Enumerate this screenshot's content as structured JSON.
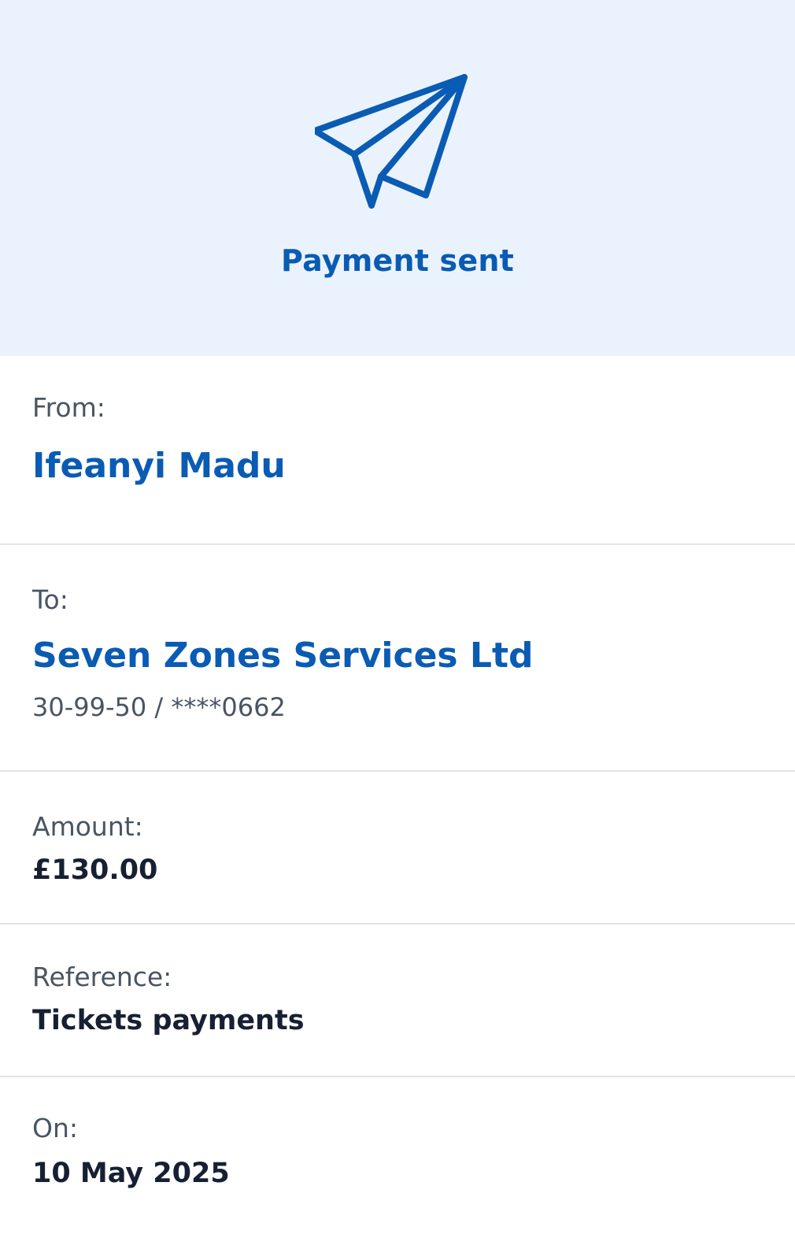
{
  "header": {
    "icon": "paper-plane-icon",
    "title": "Payment sent",
    "accent_color": "#0a5bb3",
    "background_color": "#eaf3fd"
  },
  "details": {
    "from": {
      "label": "From:",
      "value": "Ifeanyi Madu"
    },
    "to": {
      "label": "To:",
      "value": "Seven Zones Services Ltd",
      "account": "30-99-50 / ****0662"
    },
    "amount": {
      "label": "Amount:",
      "value": "£130.00"
    },
    "reference": {
      "label": "Reference:",
      "value": "Tickets payments"
    },
    "on": {
      "label": "On:",
      "value": "10 May 2025"
    }
  }
}
